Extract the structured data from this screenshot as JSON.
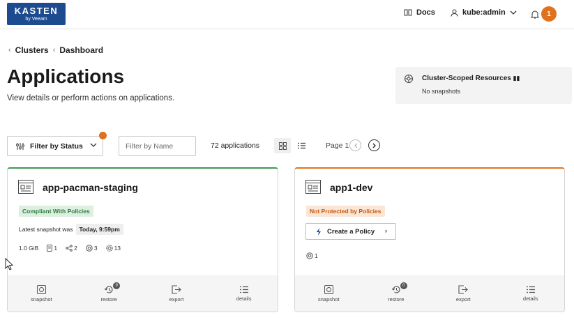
{
  "header": {
    "logo_line1": "KASTEN",
    "logo_line2": "by Veeam",
    "docs_label": "Docs",
    "user_label": "kube:admin",
    "notification_count": "1"
  },
  "breadcrumb": {
    "items": [
      "Clusters",
      "Dashboard"
    ]
  },
  "page": {
    "title": "Applications",
    "subtitle": "View details or perform actions on applications."
  },
  "cluster_scoped": {
    "title": "Cluster-Scoped Resources",
    "status": "No snapshots"
  },
  "toolbar": {
    "filter_status_label": "Filter by Status",
    "filter_name_placeholder": "Filter by Name",
    "app_count": "72 applications",
    "page_label": "Page 1"
  },
  "cards": [
    {
      "name": "app-pacman-staging",
      "badge": "Compliant With Policies",
      "snapshot_prefix": "Latest snapshot was",
      "snapshot_time": "Today, 9:59pm",
      "stats": {
        "size": "1.0 GiB",
        "volumes": "1",
        "networks": "2",
        "workloads": "3",
        "resources": "13"
      },
      "actions": [
        "snapshot",
        "restore",
        "export",
        "details"
      ],
      "restore_count": "9"
    },
    {
      "name": "app1-dev",
      "badge": "Not Protected by Policies",
      "create_policy_label": "Create a Policy",
      "workload_count": "1",
      "actions": [
        "snapshot",
        "restore",
        "export",
        "details"
      ],
      "restore_count": "0"
    }
  ],
  "colors": {
    "brand": "#1c4c8f",
    "accent": "#e0721e",
    "compliant": "#3a9a4f"
  }
}
